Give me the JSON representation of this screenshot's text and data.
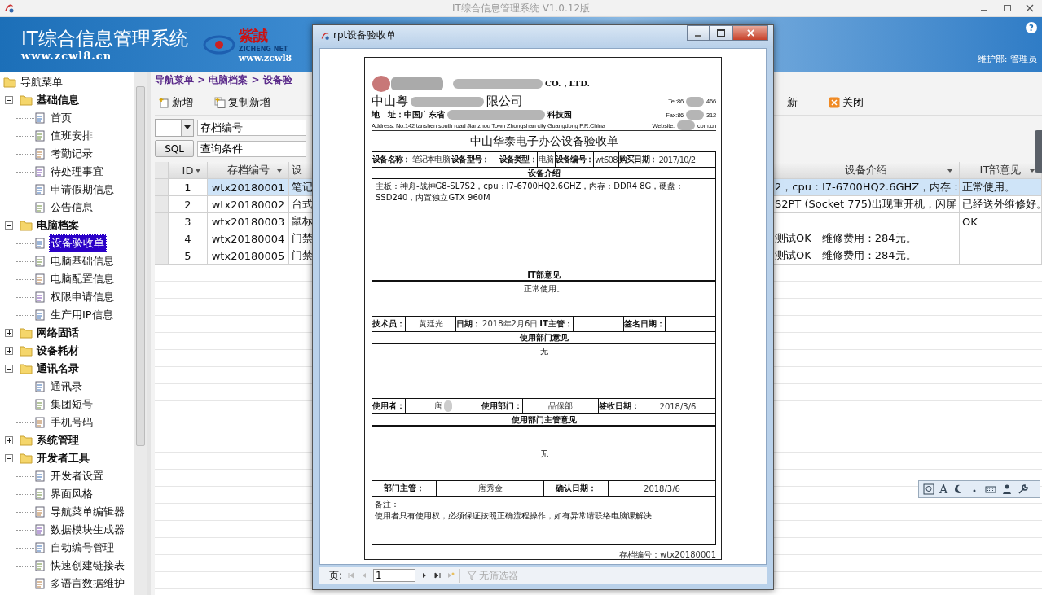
{
  "app_title": "IT综合信息管理系统 V1.0.12版",
  "header": {
    "title": "IT综合信息管理系统",
    "url": "www.zcwl8.cn",
    "logo_text": "紫誠",
    "logo_subtext": "ZICHENG NET",
    "logo_url": "www.zcwl8",
    "help": "?",
    "user": "维护部: 管理员"
  },
  "sidebar": {
    "root": "导航菜单",
    "groups": [
      {
        "label": "基础信息",
        "expanded": true,
        "selected": false,
        "children": [
          {
            "label": "首页",
            "selected": false
          },
          {
            "label": "值班安排",
            "selected": false
          },
          {
            "label": "考勤记录",
            "selected": false
          },
          {
            "label": "待处理事宜",
            "selected": false
          },
          {
            "label": "申请假期信息",
            "selected": false
          },
          {
            "label": "公告信息",
            "selected": false
          }
        ]
      },
      {
        "label": "电脑档案",
        "expanded": true,
        "selected": false,
        "children": [
          {
            "label": "设备验收单",
            "selected": true
          },
          {
            "label": "电脑基础信息",
            "selected": false
          },
          {
            "label": "电脑配置信息",
            "selected": false
          },
          {
            "label": "权限申请信息",
            "selected": false
          },
          {
            "label": "生产用IP信息",
            "selected": false
          }
        ]
      },
      {
        "label": "网络固话",
        "expanded": false,
        "selected": false
      },
      {
        "label": "设备耗材",
        "expanded": false,
        "selected": false
      },
      {
        "label": "通讯名录",
        "expanded": true,
        "selected": false,
        "children": [
          {
            "label": "通讯录",
            "selected": false
          },
          {
            "label": "集团短号",
            "selected": false
          },
          {
            "label": "手机号码",
            "selected": false
          }
        ]
      },
      {
        "label": "系统管理",
        "expanded": false,
        "selected": false
      },
      {
        "label": "开发者工具",
        "expanded": true,
        "selected": false,
        "children": [
          {
            "label": "开发者设置",
            "selected": false
          },
          {
            "label": "界面风格",
            "selected": false
          },
          {
            "label": "导航菜单编辑器",
            "selected": false
          },
          {
            "label": "数据模块生成器",
            "selected": false
          },
          {
            "label": "自动编号管理",
            "selected": false
          },
          {
            "label": "快速创建链接表",
            "selected": false
          },
          {
            "label": "多语言数据维护",
            "selected": false
          }
        ]
      }
    ]
  },
  "breadcrumb": "导航菜单 > 电脑档案 > 设备验",
  "toolbar_left": [
    {
      "label": "新增",
      "kind": "add"
    },
    {
      "label": "复制新增",
      "kind": "copy"
    }
  ],
  "toolbar_right": [
    {
      "label": "新",
      "kind": "none"
    },
    {
      "label": "关闭",
      "kind": "close"
    }
  ],
  "filter": {
    "field": "存档编号",
    "sql_button": "SQL",
    "query": "查询条件"
  },
  "table": {
    "columns_left": [
      {
        "label": "ID"
      },
      {
        "label": "存档编号"
      },
      {
        "label": "设"
      }
    ],
    "columns_right": [
      {
        "label": "设备介绍"
      },
      {
        "label": "IT部意见"
      }
    ],
    "rows": [
      {
        "id": "1",
        "archive_no": "wtx20180001",
        "column_3": "笔记",
        "description": "2，cpu：I7-6700HQ2.6GHZ，内存：",
        "it_opinion": "正常使用。",
        "selected": true
      },
      {
        "id": "2",
        "archive_no": "wtx20180002",
        "column_3": "台式",
        "description": "S2PT (Socket 775)出现重开机，闪屏",
        "it_opinion": "已经送外维修好。",
        "selected": false
      },
      {
        "id": "3",
        "archive_no": "wtx20180003",
        "column_3": "鼠标",
        "it_opinion": "OK",
        "selected": false
      },
      {
        "id": "4",
        "archive_no": "wtx20180004",
        "column_3": "门禁",
        "description": "测试OK　维修费用：284元。",
        "selected": false
      },
      {
        "id": "5",
        "archive_no": "wtx20180005",
        "column_3": "门禁",
        "description": "测试OK　维修费用：284元。",
        "selected": false
      }
    ]
  },
  "dialog": {
    "title": "rpt设备验收单",
    "report": {
      "letterhead": {
        "company_en": "CO.，LTD.",
        "company_cn_start": "中山粵",
        "company_cn_end": "限公司",
        "tel": "Tel:86",
        "tel_end": "466",
        "address_cn": "地　址：中国广东省",
        "address_cn_end": "科技园",
        "fax": "Fax:86",
        "fax_end": "312",
        "address_en": "Address: No.142 tanshen south road Jianzhou Town Zhongshan city Guangdong  P.R.China",
        "web": "Website:",
        "web_end": "com.cn"
      },
      "title": "中山华泰电子办公设备验收单",
      "info_row": [
        {
          "label": "设备名称：",
          "value": "笔记本电脑"
        },
        {
          "label": "设备型号："
        },
        {
          "label": "设备类型：",
          "value": "电脑"
        },
        {
          "label": "设备编号：",
          "value": "wt608"
        },
        {
          "label": "购买日期：",
          "value": "2017/10/2"
        }
      ],
      "intro_heading": "设备介绍",
      "intro": "主板：神舟-战神G8-SL7S2，cpu：I7-6700HQ2.6GHZ，内存：DDR4 8G，硬盘：SSD240，内置独立GTX 960M",
      "it_heading": "IT部意见",
      "it_opinion": "正常使用。",
      "it_row": [
        {
          "label": "技术员：",
          "value": "黄廷光"
        },
        {
          "label": "日期：",
          "value": "2018年2月6日"
        },
        {
          "label": "IT主管："
        },
        {
          "label": "签名日期："
        }
      ],
      "dept_heading": "使用部门意见",
      "dept_opinion": "无",
      "dept_row": [
        {
          "label": "使用者：",
          "value": "唐"
        },
        {
          "label": "使用部门：",
          "value": "品保部"
        },
        {
          "label": "签收日期：",
          "value": "2018/3/6"
        }
      ],
      "manager_heading": "使用部门主管意见",
      "manager_opinion": "无",
      "manager_row": [
        {
          "label": "部门主管：",
          "value": "唐秀金"
        },
        {
          "label": "确认日期：",
          "value": "2018/3/6"
        }
      ],
      "note_label": "备注：",
      "note": "使用者只有使用权，必须保证按照正确流程操作，如有异常请联络电脑课解决",
      "footer": "存档编号：wtx20180001"
    },
    "pager": {
      "label": "页:",
      "page": "1",
      "filter": "无筛选器"
    }
  },
  "ime_toolbar": {
    "letter": "A"
  }
}
